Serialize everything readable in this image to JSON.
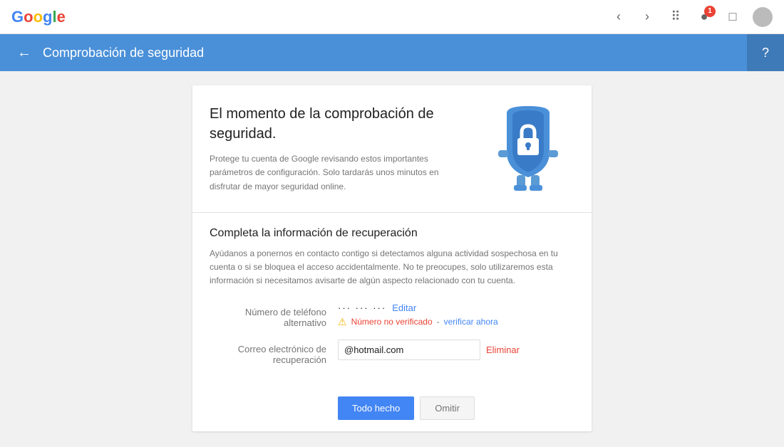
{
  "topNav": {
    "logoLetters": [
      "G",
      "o",
      "o",
      "g",
      "l",
      "e"
    ],
    "notificationCount": "1"
  },
  "pageHeader": {
    "title": "Comprobación de seguridad",
    "helpIcon": "?"
  },
  "hero": {
    "title": "El momento de la comprobación de seguridad.",
    "description": "Protege tu cuenta de Google revisando estos importantes parámetros de configuración. Solo tardarás unos minutos en disfrutar de mayor seguridad online."
  },
  "recovery": {
    "title": "Completa la información de recuperación",
    "description": "Ayúdanos a ponernos en contacto contigo si detectamos alguna actividad sospechosa en tu cuenta o si se bloquea el acceso accidentalmente. No te preocupes, solo utilizaremos esta información si necesitamos avisarte de algún aspecto relacionado con tu cuenta.",
    "phoneLabel": "Número de teléfono alternativo",
    "phoneDots": "··· ··· ···",
    "editLink": "Editar",
    "unverifiedText": "Número no verificado",
    "separator": "-",
    "verifyLink": "verificar ahora",
    "emailLabel": "Correo electrónico de\nrecuperación",
    "emailValue": "@hotmail.com",
    "removeLink": "Eliminar"
  },
  "buttons": {
    "primaryLabel": "Todo hecho",
    "secondaryLabel": "Omitir"
  }
}
